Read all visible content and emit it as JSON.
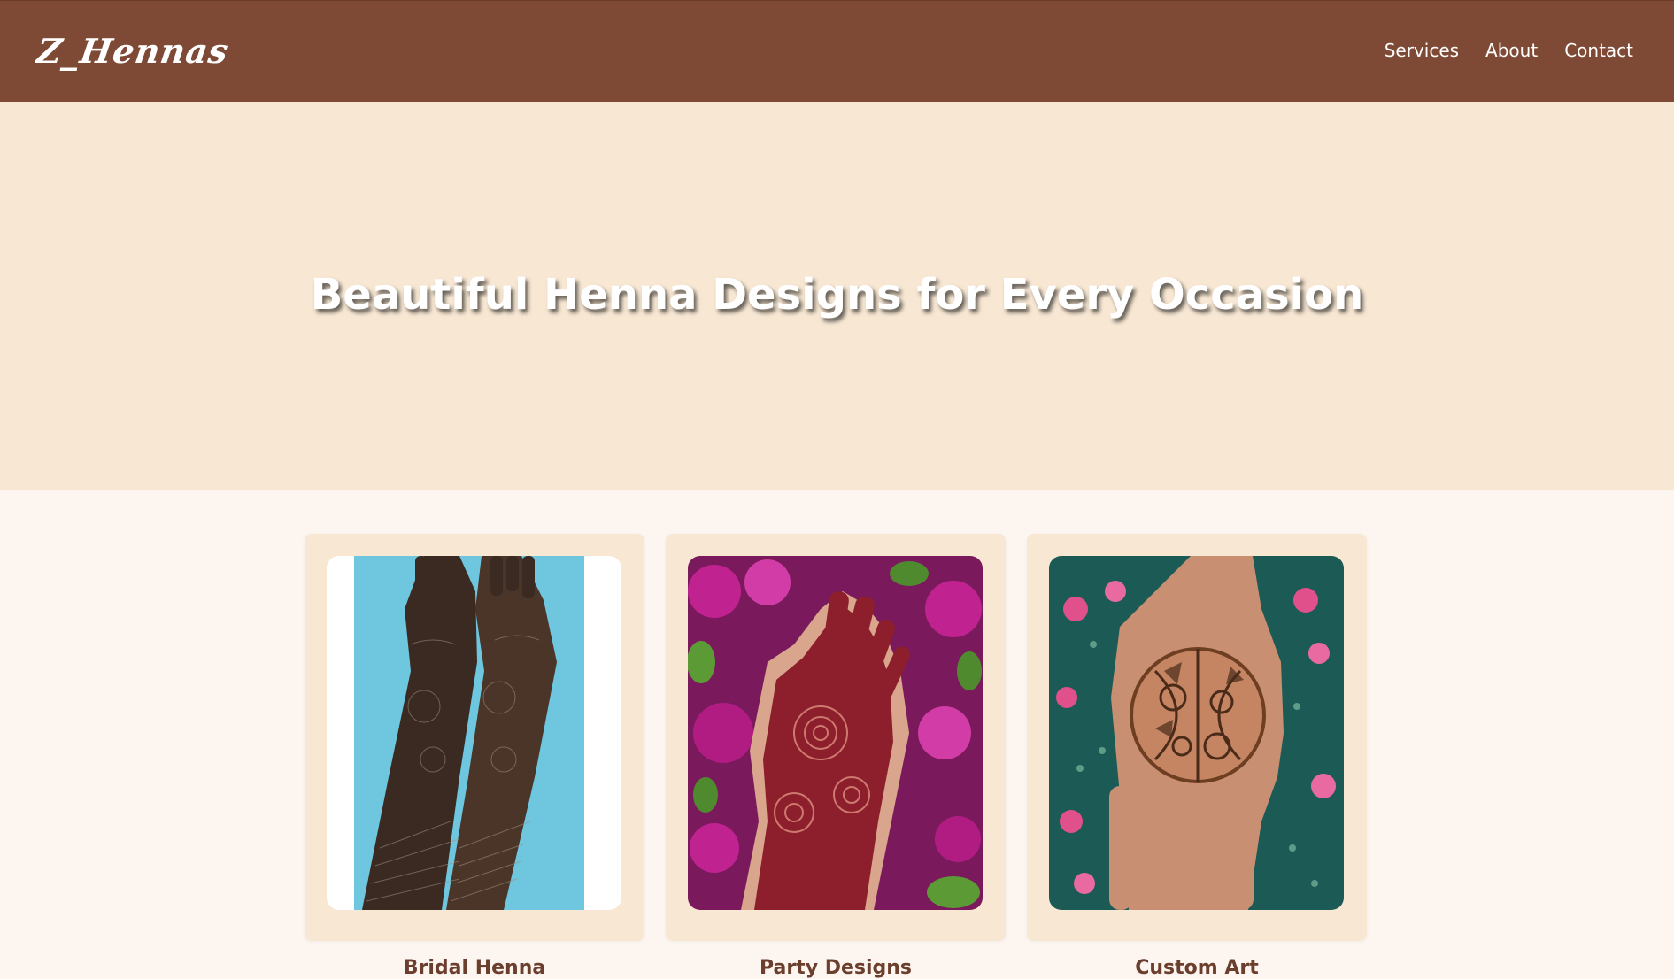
{
  "brand": {
    "logo_text": "Z_Hennas"
  },
  "nav": {
    "links": [
      "Services",
      "About",
      "Contact"
    ]
  },
  "hero": {
    "title": "Beautiful Henna Designs for Every Occasion"
  },
  "services": {
    "cards": [
      {
        "title": "Bridal Henna",
        "image": "henna-arms-on-blue-background"
      },
      {
        "title": "Party Designs",
        "image": "henna-hand-with-pink-flowers"
      },
      {
        "title": "Custom Art",
        "image": "henna-circle-on-palm"
      }
    ]
  },
  "colors": {
    "navbar": "#7f4a35",
    "hero_bg": "#f7e7d3",
    "page_bg": "#fdf6f0",
    "card_bg": "#f7e7d3",
    "card_title": "#6b3e2e"
  }
}
